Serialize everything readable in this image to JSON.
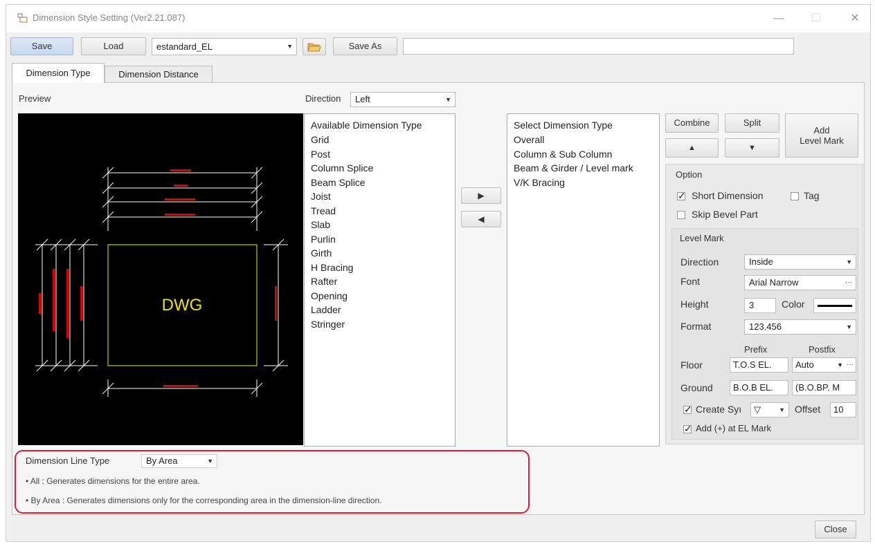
{
  "window": {
    "title": "Dimension Style Setting (Ver2.21.087)",
    "min_glyph": "—",
    "max_glyph": "☐",
    "close_glyph": "✕"
  },
  "toolbar": {
    "save_label": "Save",
    "load_label": "Load",
    "style_value": "estandard_EL",
    "save_as_label": "Save As",
    "save_as_input_value": ""
  },
  "tabs": [
    {
      "label": "Dimension Type",
      "active": true
    },
    {
      "label": "Dimension Distance",
      "active": false
    }
  ],
  "preview": {
    "label": "Preview",
    "dwg_text": "DWG",
    "colors": {
      "background": "#000000",
      "rect": "#c8c800",
      "dim_lines": "#ffffff",
      "dim_text": "#e00000",
      "dwg_text": "#e6e600"
    }
  },
  "direction": {
    "label": "Direction",
    "value": "Left"
  },
  "available": {
    "header": "Available Dimension Type",
    "items": [
      "Grid",
      "Post",
      "Column Splice",
      "Beam Splice",
      "Joist",
      "Tread",
      "Slab",
      "Purlin",
      "Girth",
      "H Bracing",
      "Rafter",
      "Opening",
      "Ladder",
      "Stringer"
    ]
  },
  "arrows": {
    "move_right": "▶",
    "move_left": "◀"
  },
  "selected": {
    "header": "Select Dimension Type",
    "items": [
      "Overall",
      "Column & Sub Column",
      "Beam & Girder / Level mark",
      "V/K Bracing"
    ]
  },
  "controls": {
    "combine_label": "Combine",
    "split_label": "Split",
    "up_label": "▲",
    "down_label": "▼",
    "add_level_mark_line1": "Add",
    "add_level_mark_line2": "Level Mark"
  },
  "option": {
    "title": "Option",
    "short_dimension": {
      "label": "Short Dimension",
      "checked": true
    },
    "tag": {
      "label": "Tag",
      "checked": false
    },
    "skip_bevel": {
      "label": "Skip Bevel Part",
      "checked": false
    }
  },
  "level_mark": {
    "title": "Level Mark",
    "direction_label": "Direction",
    "direction_value": "Inside",
    "font_label": "Font",
    "font_value": "Arial Narrow",
    "font_browse": "···",
    "height_label": "Height",
    "height_value": "3",
    "color_label": "Color",
    "color_value": "#000000",
    "format_label": "Format",
    "format_value": "123.456",
    "prefix_header": "Prefix",
    "postfix_header": "Postfix",
    "floor_label": "Floor",
    "floor_prefix": "T.O.S EL.",
    "floor_postfix": "Auto",
    "floor_browse": "···",
    "ground_label": "Ground",
    "ground_prefix": "B.O.B EL.",
    "ground_postfix": "(B.O.BP. M",
    "create_symbol": {
      "label": "Create Syı",
      "checked": true
    },
    "symbol_value": "▽",
    "offset_label": "Offset",
    "offset_value": "10",
    "add_plus": {
      "label": "Add (+) at EL Mark",
      "checked": true
    }
  },
  "dimension_line": {
    "label": "Dimension Line Type",
    "value": "By Area",
    "note_all": "• All : Generates dimensions for the entire area.",
    "note_by_area": "• By Area : Generates dimensions only for the corresponding area in the dimension-line direction."
  },
  "footer": {
    "close_label": "Close"
  }
}
